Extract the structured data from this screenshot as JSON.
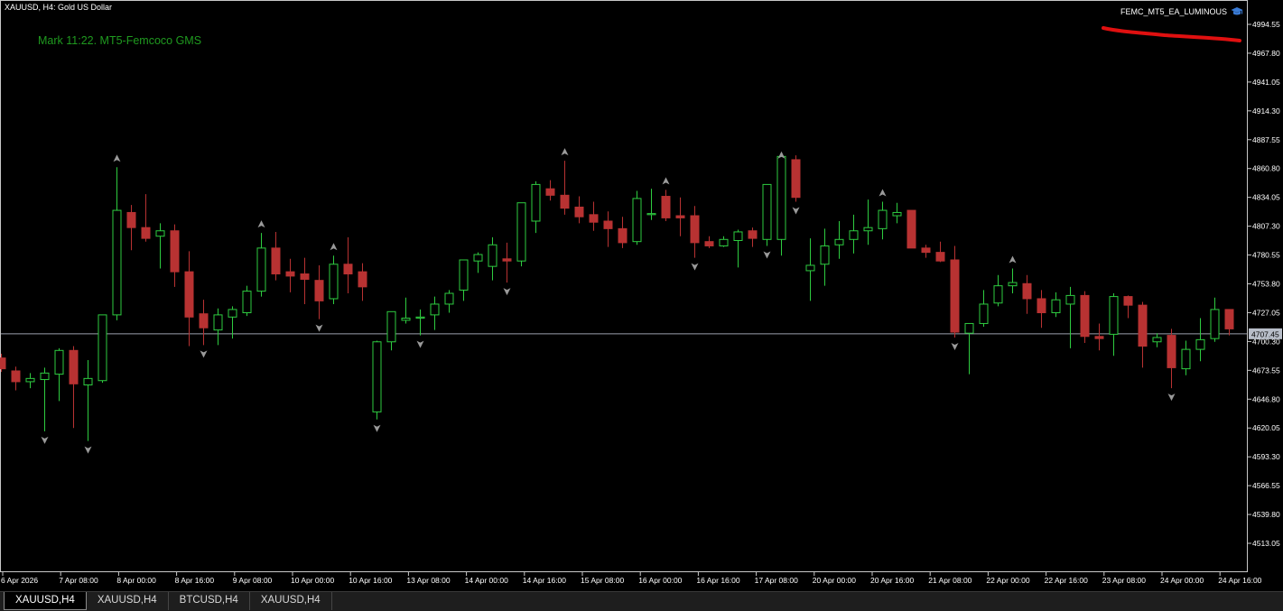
{
  "window": {
    "symbol_info": "XAUUSD, H4:  Gold US Dollar",
    "indicator_label": "Mark 11:22. MT5-Femcoco GMS",
    "ea_name": "FEMC_MT5_EA_LUMINOUS",
    "ea_icon": "graduation-cap-icon"
  },
  "colors": {
    "background": "#000000",
    "bull": "#2ecc40",
    "bear": "#b83232",
    "price_line": "#9aa0ad",
    "annotation": "#e01010"
  },
  "chart_data": {
    "type": "candlestick",
    "symbol": "XAUUSD",
    "timeframe": "H4",
    "ylim": [
      4494,
      5020
    ],
    "y_ticks": [
      "4994.55",
      "4967.80",
      "4941.05",
      "4914.30",
      "4887.55",
      "4860.80",
      "4834.05",
      "4807.30",
      "4780.55",
      "4753.80",
      "4727.05",
      "4700.30",
      "4673.55",
      "4646.80",
      "4620.05",
      "4593.30",
      "4566.55",
      "4539.80",
      "4513.05"
    ],
    "x_ticks": [
      "6 Apr 2026",
      "7 Apr 08:00",
      "8 Apr 00:00",
      "8 Apr 16:00",
      "9 Apr 08:00",
      "10 Apr 00:00",
      "10 Apr 16:00",
      "13 Apr 08:00",
      "14 Apr 00:00",
      "14 Apr 16:00",
      "15 Apr 08:00",
      "16 Apr 00:00",
      "16 Apr 16:00",
      "17 Apr 08:00",
      "20 Apr 00:00",
      "20 Apr 16:00",
      "21 Apr 08:00",
      "22 Apr 00:00",
      "22 Apr 16:00",
      "23 Apr 08:00",
      "24 Apr 00:00",
      "24 Apr 16:00"
    ],
    "current_price": "4707.45",
    "candles": [
      [
        4685,
        4689,
        4672,
        4675
      ],
      [
        4673,
        4677,
        4655,
        4663
      ],
      [
        4663,
        4671,
        4657,
        4666
      ],
      [
        4665,
        4676,
        4617,
        4671
      ],
      [
        4670,
        4694,
        4645,
        4692
      ],
      [
        4692,
        4696,
        4620,
        4661
      ],
      [
        4660,
        4683,
        4608,
        4666
      ],
      [
        4664,
        4718,
        4662,
        4725
      ],
      [
        4725,
        4862,
        4720,
        4822
      ],
      [
        4820,
        4827,
        4785,
        4806
      ],
      [
        4806,
        4837,
        4793,
        4796
      ],
      [
        4798,
        4810,
        4768,
        4803
      ],
      [
        4803,
        4809,
        4751,
        4765
      ],
      [
        4765,
        4784,
        4696,
        4723
      ],
      [
        4726,
        4739,
        4697,
        4713
      ],
      [
        4711,
        4731,
        4697,
        4725
      ],
      [
        4723,
        4733,
        4703,
        4730
      ],
      [
        4727,
        4752,
        4724,
        4747
      ],
      [
        4747,
        4801,
        4742,
        4787
      ],
      [
        4787,
        4802,
        4757,
        4763
      ],
      [
        4765,
        4777,
        4746,
        4761
      ],
      [
        4763,
        4778,
        4735,
        4758
      ],
      [
        4757,
        4771,
        4721,
        4738
      ],
      [
        4740,
        4780,
        4735,
        4772
      ],
      [
        4772,
        4797,
        4745,
        4763
      ],
      [
        4765,
        4773,
        4738,
        4751
      ],
      [
        4635,
        4701,
        4628,
        4700
      ],
      [
        4700,
        4728,
        4692,
        4728
      ],
      [
        4720,
        4741,
        4717,
        4722
      ],
      [
        4722,
        4730,
        4706,
        4723
      ],
      [
        4725,
        4742,
        4711,
        4735
      ],
      [
        4735,
        4748,
        4727,
        4745
      ],
      [
        4748,
        4776,
        4738,
        4776
      ],
      [
        4775,
        4783,
        4764,
        4781
      ],
      [
        4770,
        4797,
        4757,
        4790
      ],
      [
        4777,
        4792,
        4755,
        4775
      ],
      [
        4775,
        4829,
        4770,
        4829
      ],
      [
        4812,
        4849,
        4801,
        4846
      ],
      [
        4842,
        4850,
        4831,
        4836
      ],
      [
        4836,
        4868,
        4818,
        4824
      ],
      [
        4825,
        4835,
        4810,
        4816
      ],
      [
        4818,
        4830,
        4803,
        4811
      ],
      [
        4812,
        4821,
        4788,
        4805
      ],
      [
        4805,
        4816,
        4787,
        4792
      ],
      [
        4793,
        4840,
        4790,
        4833
      ],
      [
        4818,
        4842,
        4813,
        4819
      ],
      [
        4835,
        4841,
        4812,
        4815
      ],
      [
        4817,
        4834,
        4798,
        4815
      ],
      [
        4817,
        4826,
        4778,
        4792
      ],
      [
        4793,
        4798,
        4787,
        4789
      ],
      [
        4789,
        4798,
        4788,
        4795
      ],
      [
        4794,
        4804,
        4769,
        4802
      ],
      [
        4803,
        4806,
        4788,
        4796
      ],
      [
        4795,
        4837,
        4789,
        4846
      ],
      [
        4795,
        4865,
        4780,
        4872
      ],
      [
        4869,
        4873,
        4830,
        4834
      ],
      [
        4766,
        4796,
        4738,
        4771
      ],
      [
        4772,
        4805,
        4752,
        4789
      ],
      [
        4790,
        4812,
        4777,
        4795
      ],
      [
        4795,
        4818,
        4782,
        4803
      ],
      [
        4803,
        4832,
        4790,
        4806
      ],
      [
        4805,
        4830,
        4795,
        4822
      ],
      [
        4817,
        4829,
        4810,
        4820
      ],
      [
        4822,
        4822,
        4788,
        4787
      ],
      [
        4787,
        4790,
        4778,
        4783
      ],
      [
        4783,
        4793,
        4774,
        4775
      ],
      [
        4776,
        4789,
        4704,
        4709
      ],
      [
        4708,
        4717,
        4670,
        4717
      ],
      [
        4717,
        4748,
        4714,
        4735
      ],
      [
        4736,
        4762,
        4733,
        4752
      ],
      [
        4752,
        4768,
        4745,
        4755
      ],
      [
        4754,
        4762,
        4726,
        4740
      ],
      [
        4740,
        4748,
        4713,
        4727
      ],
      [
        4727,
        4746,
        4723,
        4739
      ],
      [
        4735,
        4751,
        4694,
        4743
      ],
      [
        4743,
        4747,
        4699,
        4705
      ],
      [
        4705,
        4717,
        4692,
        4703
      ],
      [
        4707,
        4745,
        4687,
        4742
      ],
      [
        4742,
        4743,
        4722,
        4734
      ],
      [
        4734,
        4737,
        4676,
        4696
      ],
      [
        4700,
        4708,
        4695,
        4704
      ],
      [
        4706,
        4712,
        4657,
        4676
      ],
      [
        4675,
        4701,
        4669,
        4693
      ],
      [
        4693,
        4722,
        4682,
        4702
      ],
      [
        4703,
        4741,
        4700,
        4730
      ],
      [
        4730,
        4730,
        4706,
        4712
      ]
    ],
    "fractal_up": [
      8,
      18,
      23,
      39,
      46,
      54,
      61,
      70
    ],
    "fractal_down": [
      3,
      6,
      14,
      22,
      26,
      29,
      35,
      48,
      53,
      55,
      66,
      81
    ]
  },
  "tabs": [
    {
      "label": "XAUUSD,H4",
      "active": true
    },
    {
      "label": "XAUUSD,H4",
      "active": false
    },
    {
      "label": "BTCUSD,H4",
      "active": false
    },
    {
      "label": "XAUUSD,H4",
      "active": false
    }
  ]
}
